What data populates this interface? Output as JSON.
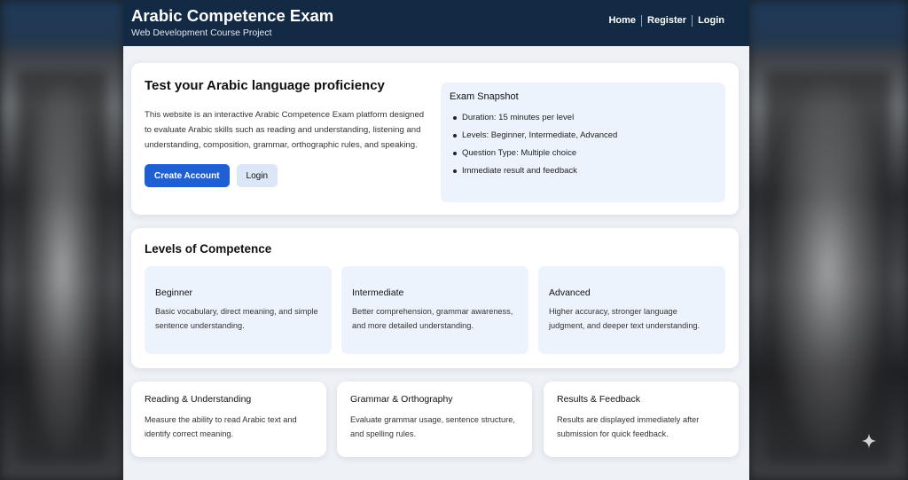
{
  "header": {
    "title": "Arabic Competence Exam",
    "subtitle": "Web Development Course Project",
    "nav": [
      "Home",
      "Register",
      "Login"
    ]
  },
  "hero": {
    "title": "Test your Arabic language proficiency",
    "text": "This website is an interactive Arabic Competence Exam platform designed to evaluate Arabic skills such as reading and understanding, listening and understanding, composition, grammar, orthographic rules, and speaking.",
    "primary_button": "Create Account",
    "secondary_button": "Login",
    "snapshot": {
      "title": "Exam Snapshot",
      "items": [
        "Duration: 15 minutes per level",
        "Levels: Beginner, Intermediate, Advanced",
        "Question Type: Multiple choice",
        "Immediate result and feedback"
      ]
    }
  },
  "levels": {
    "title": "Levels of Competence",
    "items": [
      {
        "name": "Beginner",
        "desc": "Basic vocabulary, direct meaning, and simple sentence understanding."
      },
      {
        "name": "Intermediate",
        "desc": "Better comprehension, grammar awareness, and more detailed understanding."
      },
      {
        "name": "Advanced",
        "desc": "Higher accuracy, stronger language judgment, and deeper text understanding."
      }
    ]
  },
  "features": [
    {
      "title": "Reading & Understanding",
      "desc": "Measure the ability to read Arabic text and identify correct meaning."
    },
    {
      "title": "Grammar & Orthography",
      "desc": "Evaluate grammar usage, sentence structure, and spelling rules."
    },
    {
      "title": "Results & Feedback",
      "desc": "Results are displayed immediately after submission for quick feedback."
    }
  ],
  "colors": {
    "header_bg": "#132a45",
    "primary": "#1f5fd6",
    "panel_bg": "#edf3fd"
  },
  "icons": {
    "corner": "sparkle-icon"
  }
}
